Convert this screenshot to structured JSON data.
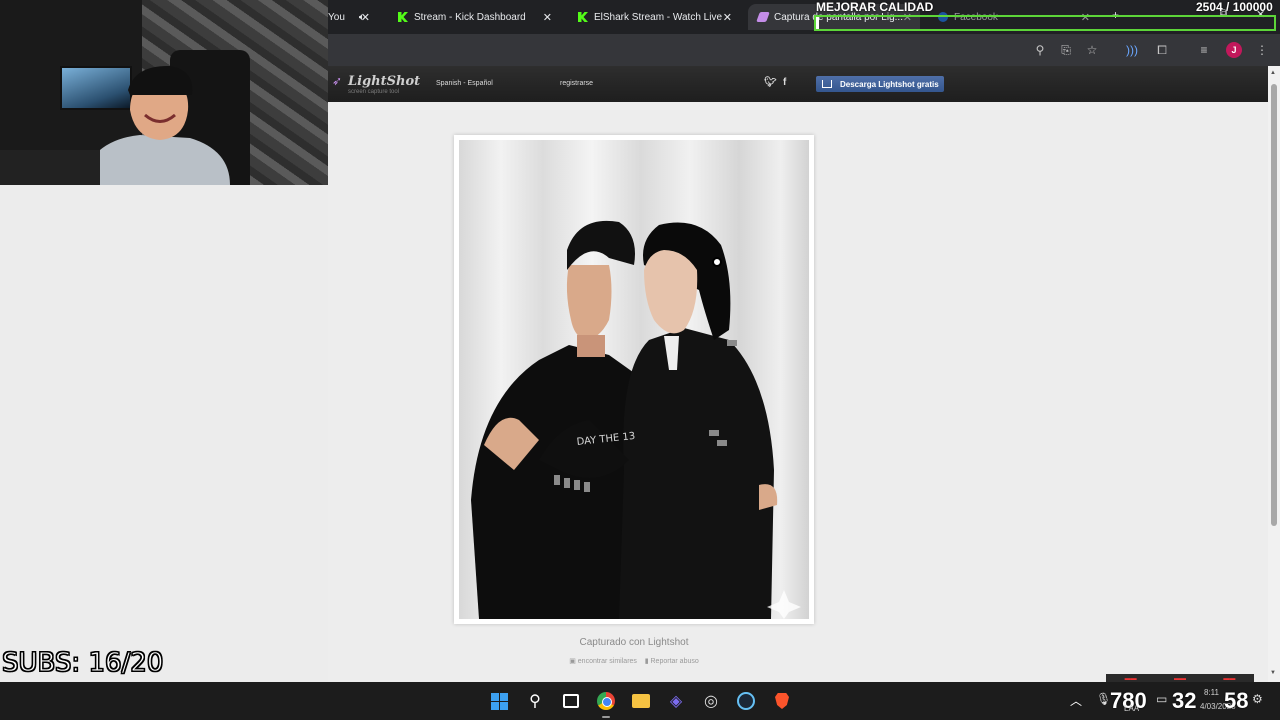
{
  "browser": {
    "tabs": [
      {
        "label": "You",
        "icon": "speaker-icon"
      },
      {
        "label": "Stream - Kick Dashboard"
      },
      {
        "label": "ElShark Stream - Watch Live"
      },
      {
        "label": "Captura de pantalla por Lig..."
      },
      {
        "label": "Facebook"
      }
    ]
  },
  "lightshot": {
    "logo": "LightShot",
    "tagline": "screen capture tool",
    "language": "Spanish - Español",
    "register": "registrarse",
    "twitter": "twitter-icon",
    "facebook": "f",
    "download_label": "Descarga Lightshot gratis",
    "caption": "Capturado con Lightshot",
    "find_similar": "encontrar similares",
    "report_abuse": "Reportar abuso"
  },
  "stream_overlay": {
    "title": "MEJORAR CALIDAD",
    "counter": "2504  / 100000",
    "progress": 0.025,
    "subs": "SUBS: 16/20",
    "accent": "#5dd639"
  },
  "taskbar": {
    "tray_value_1": "780",
    "tray_value_2": "32",
    "tray_value_3": "58",
    "time": "8:11",
    "date": "4/03/2025",
    "lang": "LAA"
  }
}
